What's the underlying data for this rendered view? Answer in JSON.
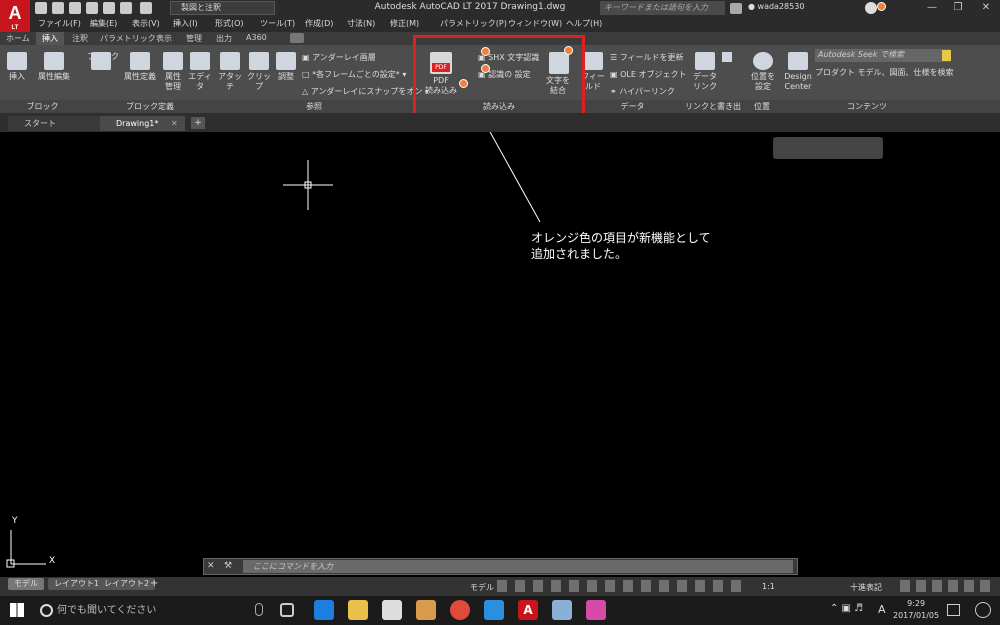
{
  "app": {
    "logo": "A",
    "logo_sub": "LT",
    "title": "Autodesk AutoCAD LT 2017   Drawing1.dwg",
    "workspace": "製図と注釈",
    "search_placeholder": "キーワードまたは語句を入力",
    "user": "wada28530"
  },
  "menu": [
    "ファイル(F)",
    "編集(E)",
    "表示(V)",
    "挿入(I)",
    "形式(O)",
    "ツール(T)",
    "作成(D)",
    "寸法(N)",
    "修正(M)",
    "パラメトリック(P)",
    "ウィンドウ(W)",
    "ヘルプ(H)"
  ],
  "ribbon_tabs": [
    "ホーム",
    "挿入",
    "注釈",
    "パラメトリック",
    "表示",
    "管理",
    "出力",
    "A360"
  ],
  "ribbon": {
    "block": {
      "label": "ブロック",
      "buttons": [
        "挿入",
        "属性編集"
      ]
    },
    "blockdef": {
      "label": "ブロック定義",
      "buttons": [
        "ブロック\n作成",
        "属性定義",
        "属性\n管理",
        "エディタ"
      ]
    },
    "ref": {
      "label": "参照",
      "buttons": [
        "アタッチ",
        "クリップ",
        "調整"
      ],
      "small": [
        "アンダーレイ画層",
        "*各フレームごとの設定*",
        "アンダーレイにスナップをオン"
      ]
    },
    "import": {
      "label": "読み込み",
      "pdf_button": "PDF\n読み込み",
      "pdf_icon_text": "PDF",
      "small": [
        "SHX 文字認識",
        "認識の 設定"
      ],
      "text_button": "文字を\n結合"
    },
    "data": {
      "label": "データ",
      "buttons": [
        "フィールド"
      ],
      "small": [
        "フィールドを更新",
        "OLE オブジェクト",
        "ハイパーリンク"
      ]
    },
    "link": {
      "label": "リンクと書き出し",
      "buttons": [
        "データ\nリンク"
      ]
    },
    "location": {
      "label": "位置",
      "buttons": [
        "位置を\n設定"
      ]
    },
    "content": {
      "label": "コンテンツ",
      "buttons": [
        "Design\nCenter"
      ],
      "seek_placeholder": "Autodesk Seek で検索",
      "seek_desc": "プロダクト モデル、図面、仕様を検索"
    }
  },
  "doc_tabs": [
    "スタート",
    "Drawing1*"
  ],
  "annotation": "オレンジ色の項目が新機能として\n追加されました。",
  "ucs": {
    "x": "X",
    "y": "Y"
  },
  "command_placeholder": "ここにコマンドを入力",
  "layout_tabs": [
    "モデル",
    "レイアウト1",
    "レイアウト2"
  ],
  "status": {
    "model": "モデル",
    "scale": "1:1",
    "units": "十進表記"
  },
  "taskbar": {
    "search": "何でも聞いてください",
    "time": "9:29",
    "date": "2017/01/05",
    "ime": "A"
  },
  "colors": {
    "accent": "#e02020",
    "new_feature": "#f07f3c",
    "app": "#c8141c"
  }
}
